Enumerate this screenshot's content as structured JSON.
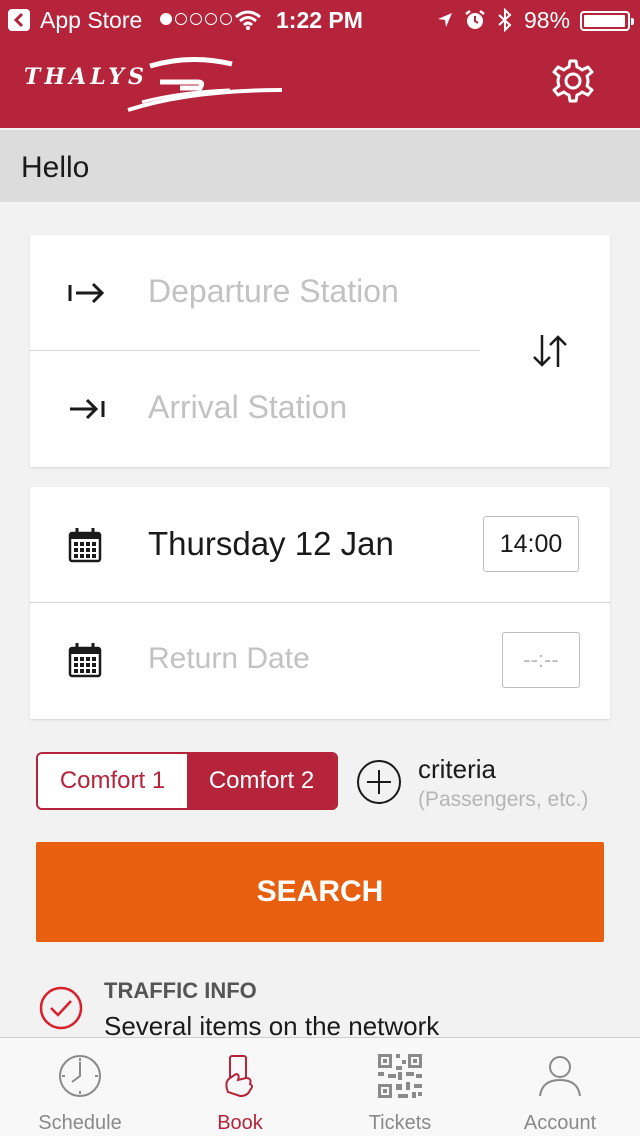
{
  "status_bar": {
    "back_app": "App Store",
    "time": "1:22 PM",
    "battery": "98%",
    "signal_bars": 1,
    "icons": [
      "wifi-icon",
      "location-icon",
      "alarm-icon",
      "bluetooth-icon",
      "battery-icon"
    ]
  },
  "header": {
    "logo_text": "THALYS",
    "settings_icon": "gear-icon"
  },
  "greeting": "Hello",
  "stations": {
    "departure_placeholder": "Departure Station",
    "arrival_placeholder": "Arrival Station",
    "swap_icon": "swap-arrows-icon"
  },
  "dates": {
    "outbound_date": "Thursday 12 Jan",
    "outbound_time": "14:00",
    "return_placeholder": "Return Date",
    "return_time": "--:--"
  },
  "comfort": {
    "options": [
      "Comfort 1",
      "Comfort 2"
    ],
    "selected": "Comfort 2"
  },
  "criteria": {
    "title": "criteria",
    "subtitle": "(Passengers, etc.)"
  },
  "search_label": "SEARCH",
  "traffic": {
    "title": "TRAFFIC INFO",
    "text": "Several items on the network"
  },
  "tabs": [
    {
      "label": "Schedule",
      "icon": "clock-icon"
    },
    {
      "label": "Book",
      "icon": "ticket-hand-icon"
    },
    {
      "label": "Tickets",
      "icon": "qr-code-icon"
    },
    {
      "label": "Account",
      "icon": "user-icon"
    }
  ],
  "active_tab": "Book",
  "colors": {
    "brand_red": "#b5243a",
    "search_orange": "#e8600f"
  }
}
